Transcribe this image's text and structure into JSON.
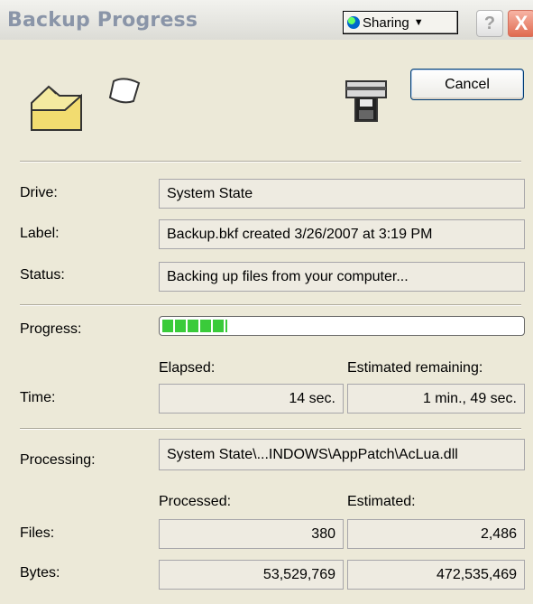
{
  "window": {
    "title": "Backup Progress",
    "sharing_label": "Sharing",
    "help_label": "?",
    "close_label": "X"
  },
  "actions": {
    "cancel_label": "Cancel"
  },
  "fields": {
    "drive_label": "Drive:",
    "drive_value": "System State",
    "label_label": "Label:",
    "label_value": "Backup.bkf created 3/26/2007 at 3:19 PM",
    "status_label": "Status:",
    "status_value": "Backing up files from your computer..."
  },
  "progress": {
    "label": "Progress:",
    "fraction": 0.18,
    "color": "#3acb3a"
  },
  "time": {
    "label": "Time:",
    "elapsed_header": "Elapsed:",
    "remaining_header": "Estimated remaining:",
    "elapsed_value": "14 sec.",
    "remaining_value": "1 min., 49 sec."
  },
  "processing": {
    "label": "Processing:",
    "value": "System State\\...INDOWS\\AppPatch\\AcLua.dll"
  },
  "counts": {
    "processed_header": "Processed:",
    "estimated_header": "Estimated:",
    "files_label": "Files:",
    "files_processed": "380",
    "files_estimated": "2,486",
    "bytes_label": "Bytes:",
    "bytes_processed": "53,529,769",
    "bytes_estimated": "472,535,469"
  }
}
